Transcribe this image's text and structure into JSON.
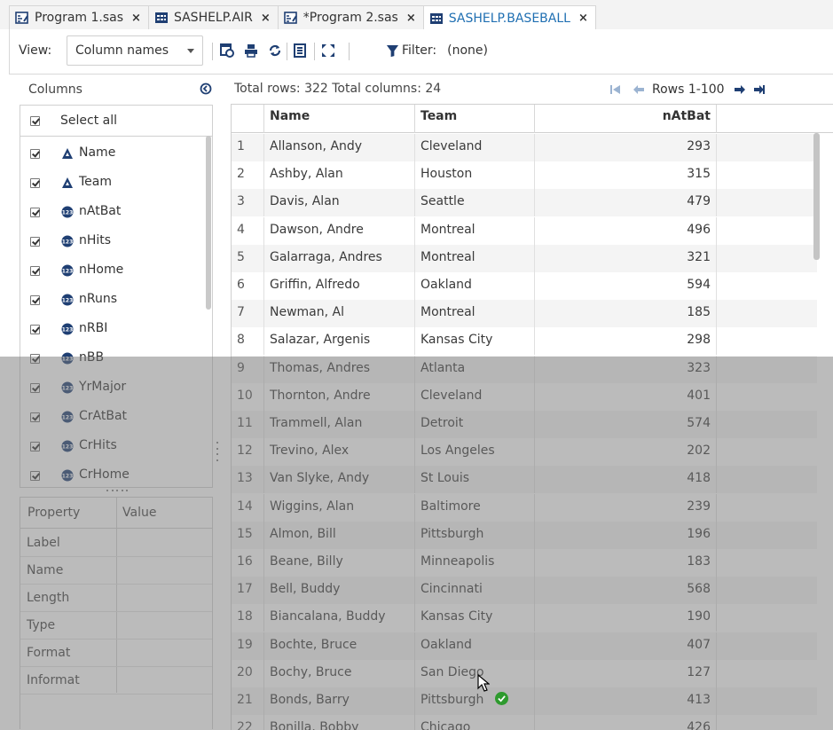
{
  "tabs": [
    {
      "label": "Program 1.sas",
      "icon": "program-icon",
      "active": false
    },
    {
      "label": "SASHELP.AIR",
      "icon": "table-icon",
      "active": false
    },
    {
      "label": "*Program 2.sas",
      "icon": "program-icon",
      "active": false
    },
    {
      "label": "SASHELP.BASEBALL",
      "icon": "table-icon",
      "active": true
    }
  ],
  "toolbar": {
    "view_label": "View:",
    "view_value": "Column names",
    "filter_label": "Filter:",
    "filter_value": "(none)"
  },
  "columns_panel": {
    "title": "Columns",
    "select_all": "Select all",
    "items": [
      {
        "name": "Name",
        "type": "char"
      },
      {
        "name": "Team",
        "type": "char"
      },
      {
        "name": "nAtBat",
        "type": "num"
      },
      {
        "name": "nHits",
        "type": "num"
      },
      {
        "name": "nHome",
        "type": "num"
      },
      {
        "name": "nRuns",
        "type": "num"
      },
      {
        "name": "nRBI",
        "type": "num"
      },
      {
        "name": "nBB",
        "type": "num"
      },
      {
        "name": "YrMajor",
        "type": "num"
      },
      {
        "name": "CrAtBat",
        "type": "num"
      },
      {
        "name": "CrHits",
        "type": "num"
      },
      {
        "name": "CrHome",
        "type": "num"
      }
    ]
  },
  "property_panel": {
    "header_property": "Property",
    "header_value": "Value",
    "rows": [
      "Label",
      "Name",
      "Length",
      "Type",
      "Format",
      "Informat"
    ]
  },
  "grid": {
    "info": "Total rows: 322  Total columns: 24",
    "pager_text": "Rows 1-100",
    "headers": [
      "Name",
      "Team",
      "nAtBat"
    ],
    "rows": [
      [
        "1",
        "Allanson, Andy",
        "Cleveland",
        "293"
      ],
      [
        "2",
        "Ashby, Alan",
        "Houston",
        "315"
      ],
      [
        "3",
        "Davis, Alan",
        "Seattle",
        "479"
      ],
      [
        "4",
        "Dawson, Andre",
        "Montreal",
        "496"
      ],
      [
        "5",
        "Galarraga, Andres",
        "Montreal",
        "321"
      ],
      [
        "6",
        "Griffin, Alfredo",
        "Oakland",
        "594"
      ],
      [
        "7",
        "Newman, Al",
        "Montreal",
        "185"
      ],
      [
        "8",
        "Salazar, Argenis",
        "Kansas City",
        "298"
      ],
      [
        "9",
        "Thomas, Andres",
        "Atlanta",
        "323"
      ],
      [
        "10",
        "Thornton, Andre",
        "Cleveland",
        "401"
      ],
      [
        "11",
        "Trammell, Alan",
        "Detroit",
        "574"
      ],
      [
        "12",
        "Trevino, Alex",
        "Los Angeles",
        "202"
      ],
      [
        "13",
        "Van Slyke, Andy",
        "St Louis",
        "418"
      ],
      [
        "14",
        "Wiggins, Alan",
        "Baltimore",
        "239"
      ],
      [
        "15",
        "Almon, Bill",
        "Pittsburgh",
        "196"
      ],
      [
        "16",
        "Beane, Billy",
        "Minneapolis",
        "183"
      ],
      [
        "17",
        "Bell, Buddy",
        "Cincinnati",
        "568"
      ],
      [
        "18",
        "Biancalana, Buddy",
        "Kansas City",
        "190"
      ],
      [
        "19",
        "Bochte, Bruce",
        "Oakland",
        "407"
      ],
      [
        "20",
        "Bochy, Bruce",
        "San Diego",
        "127"
      ],
      [
        "21",
        "Bonds, Barry",
        "Pittsburgh",
        "413"
      ],
      [
        "22",
        "Bonilla, Bobby",
        "Chicago",
        "426"
      ]
    ]
  },
  "colors": {
    "active_tab_text": "#1f6fb2",
    "char_icon": "#1f3f73",
    "num_icon": "#1f3f73",
    "ok_badge": "#2e9a2e"
  }
}
